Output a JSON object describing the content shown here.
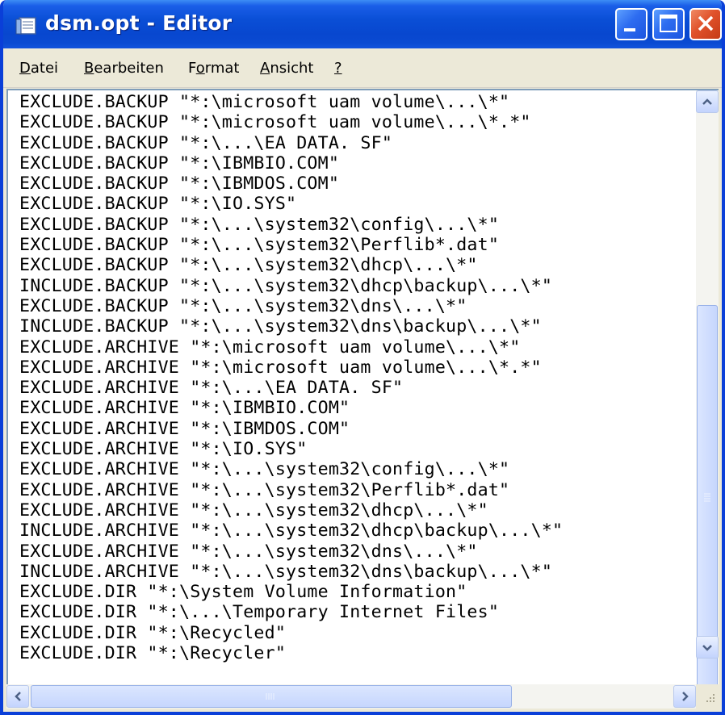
{
  "window": {
    "title": "dsm.opt - Editor"
  },
  "menu": [
    {
      "pre": "",
      "u": "D",
      "post": "atei"
    },
    {
      "pre": "",
      "u": "B",
      "post": "earbeiten"
    },
    {
      "pre": "F",
      "u": "o",
      "post": "rmat"
    },
    {
      "pre": "",
      "u": "A",
      "post": "nsicht"
    },
    {
      "pre": "",
      "u": "?",
      "post": ""
    }
  ],
  "editor": {
    "lines": [
      "EXCLUDE.BACKUP \"*:\\microsoft uam volume\\...\\*\"",
      "EXCLUDE.BACKUP \"*:\\microsoft uam volume\\...\\*.*\"",
      "EXCLUDE.BACKUP \"*:\\...\\EA DATA. SF\"",
      "EXCLUDE.BACKUP \"*:\\IBMBIO.COM\"",
      "EXCLUDE.BACKUP \"*:\\IBMDOS.COM\"",
      "EXCLUDE.BACKUP \"*:\\IO.SYS\"",
      "EXCLUDE.BACKUP \"*:\\...\\system32\\config\\...\\*\"",
      "EXCLUDE.BACKUP \"*:\\...\\system32\\Perflib*.dat\"",
      "EXCLUDE.BACKUP \"*:\\...\\system32\\dhcp\\...\\*\"",
      "INCLUDE.BACKUP \"*:\\...\\system32\\dhcp\\backup\\...\\*\"",
      "EXCLUDE.BACKUP \"*:\\...\\system32\\dns\\...\\*\"",
      "INCLUDE.BACKUP \"*:\\...\\system32\\dns\\backup\\...\\*\"",
      "EXCLUDE.ARCHIVE \"*:\\microsoft uam volume\\...\\*\"",
      "EXCLUDE.ARCHIVE \"*:\\microsoft uam volume\\...\\*.*\"",
      "EXCLUDE.ARCHIVE \"*:\\...\\EA DATA. SF\"",
      "EXCLUDE.ARCHIVE \"*:\\IBMBIO.COM\"",
      "EXCLUDE.ARCHIVE \"*:\\IBMDOS.COM\"",
      "EXCLUDE.ARCHIVE \"*:\\IO.SYS\"",
      "EXCLUDE.ARCHIVE \"*:\\...\\system32\\config\\...\\*\"",
      "EXCLUDE.ARCHIVE \"*:\\...\\system32\\Perflib*.dat\"",
      "EXCLUDE.ARCHIVE \"*:\\...\\system32\\dhcp\\...\\*\"",
      "INCLUDE.ARCHIVE \"*:\\...\\system32\\dhcp\\backup\\...\\*\"",
      "EXCLUDE.ARCHIVE \"*:\\...\\system32\\dns\\...\\*\"",
      "INCLUDE.ARCHIVE \"*:\\...\\system32\\dns\\backup\\...\\*\"",
      "EXCLUDE.DIR \"*:\\System Volume Information\"",
      "EXCLUDE.DIR \"*:\\...\\Temporary Internet Files\"",
      "EXCLUDE.DIR \"*:\\Recycled\"",
      "EXCLUDE.DIR \"*:\\Recycler\""
    ]
  },
  "icons": {
    "app": "notepad-icon",
    "minimize": "minimize-icon",
    "maximize": "maximize-icon",
    "close": "close-icon",
    "scroll_up": "arrow-up-icon",
    "scroll_down": "arrow-down-icon",
    "scroll_left": "arrow-left-icon",
    "scroll_right": "arrow-right-icon",
    "grip": "resize-grip-icon"
  },
  "colors": {
    "titlebar": "#0a4fd6",
    "close_button": "#e0522b",
    "window_frame": "#0a3fd8"
  }
}
